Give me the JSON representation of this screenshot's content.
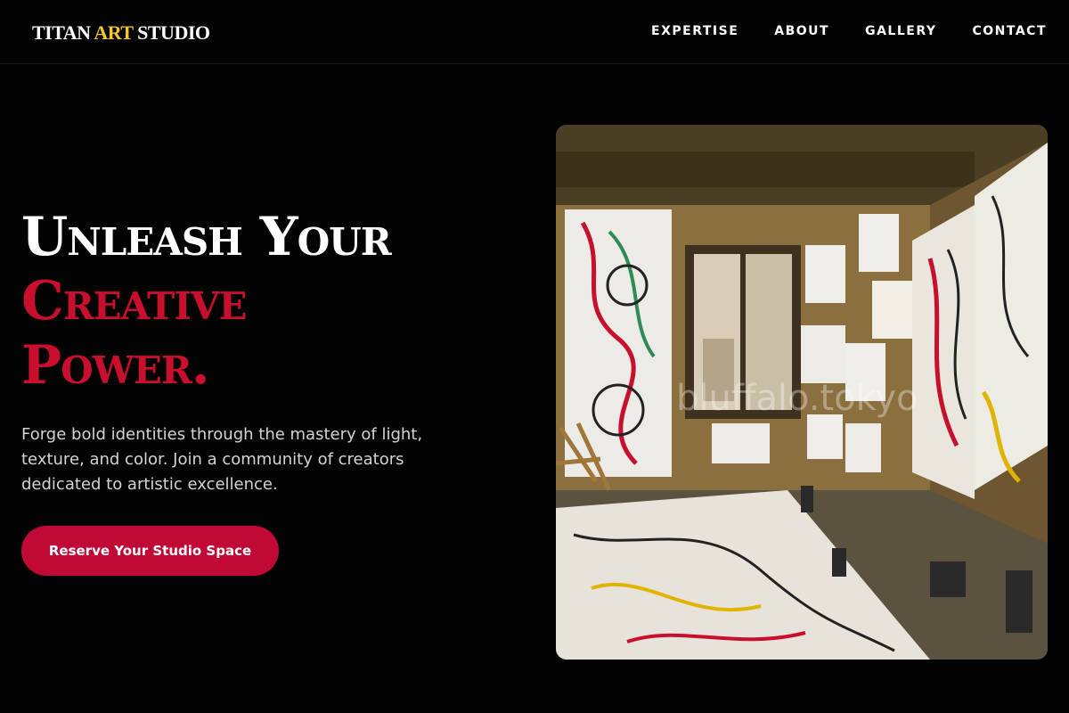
{
  "brand": {
    "word1": "TITAN",
    "word2": "ART",
    "word3": "STUDIO",
    "accent_color": "#f3c623"
  },
  "nav": {
    "items": [
      {
        "label": "EXPERTISE"
      },
      {
        "label": "ABOUT"
      },
      {
        "label": "GALLERY"
      },
      {
        "label": "CONTACT"
      }
    ]
  },
  "hero": {
    "line1": "Unleash Your",
    "line2": "Creative",
    "line3": "Power.",
    "subtitle": "Forge bold identities through the mastery of light, texture, and color. Join a community of creators dedicated to artistic excellence.",
    "cta_label": "Reserve Your Studio Space",
    "highlight_color": "#c8102e"
  },
  "image": {
    "watermark": "bluffalo.tokyo",
    "icon": "art-studio-photo"
  }
}
